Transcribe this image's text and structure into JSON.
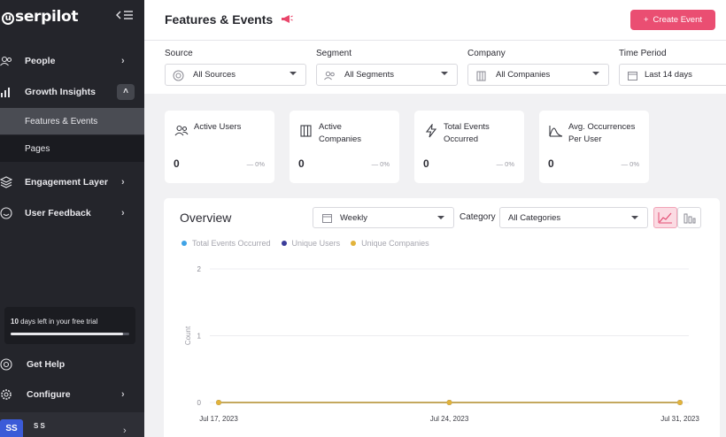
{
  "brand": {
    "name": "serpilot",
    "initial": "u"
  },
  "sidebar": {
    "items": [
      {
        "label": "People",
        "icon": "people-icon"
      },
      {
        "label": "Growth Insights",
        "icon": "bar-chart-icon"
      },
      {
        "label": "Engagement Layer",
        "icon": "layers-icon"
      },
      {
        "label": "User Feedback",
        "icon": "smile-icon"
      }
    ],
    "subitems": [
      {
        "label": "Features & Events"
      },
      {
        "label": "Pages"
      }
    ],
    "trial": {
      "days": "10",
      "text": "days left in your free trial",
      "progress": 0.95
    },
    "bottom": [
      {
        "label": "Get Help",
        "icon": "help-icon"
      },
      {
        "label": "Configure",
        "icon": "gear-icon"
      }
    ],
    "user": {
      "initials": "SS",
      "name": "S S"
    }
  },
  "header": {
    "title": "Features & Events",
    "create_label": "Create Event"
  },
  "filters": [
    {
      "label": "Source",
      "value": "All Sources"
    },
    {
      "label": "Segment",
      "value": "All Segments"
    },
    {
      "label": "Company",
      "value": "All Companies"
    },
    {
      "label": "Time Period",
      "value": "Last 14 days"
    }
  ],
  "cards": [
    {
      "title_1": "Active Users",
      "title_2": "",
      "value": "0",
      "delta": "— 0%"
    },
    {
      "title_1": "Active",
      "title_2": "Companies",
      "value": "0",
      "delta": "— 0%"
    },
    {
      "title_1": "Total Events",
      "title_2": "Occurred",
      "value": "0",
      "delta": "— 0%"
    },
    {
      "title_1": "Avg. Occurrences",
      "title_2": "Per User",
      "value": "0",
      "delta": "— 0%"
    }
  ],
  "overview": {
    "title": "Overview",
    "interval": "Weekly",
    "category_label": "Category",
    "category_value": "All Categories"
  },
  "chart_data": {
    "type": "line",
    "x": [
      "Jul 17, 2023",
      "Jul 24, 2023",
      "Jul 31, 2023"
    ],
    "series": [
      {
        "name": "Total Events Occurred",
        "color": "#3fa3e6",
        "values": [
          0,
          0,
          0
        ]
      },
      {
        "name": "Unique Users",
        "color": "#3b3d9a",
        "values": [
          0,
          0,
          0
        ]
      },
      {
        "name": "Unique Companies",
        "color": "#e2b33b",
        "values": [
          0,
          0,
          0
        ]
      }
    ],
    "ylabel": "Count",
    "yticks": [
      "0",
      "1",
      "2"
    ],
    "ylim": [
      0,
      2
    ],
    "grid": true,
    "legend": "top-left"
  }
}
